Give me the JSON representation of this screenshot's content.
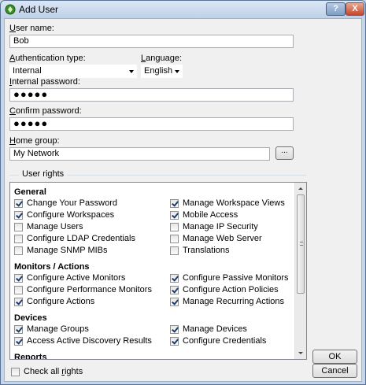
{
  "window": {
    "title": "Add User",
    "help_label": "?",
    "close_label": "X"
  },
  "form": {
    "username_label_u": "U",
    "username_label_rest": "ser name:",
    "username_value": "Bob",
    "auth_label_u": "A",
    "auth_label_rest": "uthentication type:",
    "auth_value": "Internal",
    "language_label_u": "L",
    "language_label_rest": "anguage:",
    "language_value": "English",
    "internal_password_label_u": "I",
    "internal_password_label_rest": "nternal password:",
    "internal_password_value": "●●●●●",
    "confirm_label_u": "C",
    "confirm_label_rest": "onfirm password:",
    "confirm_value": "●●●●●",
    "home_group_label_u": "H",
    "home_group_label_rest": "ome group:",
    "home_group_value": "My Network",
    "browse_label": "..."
  },
  "user_rights": {
    "group_title": "User rights",
    "sections": [
      {
        "name": "General",
        "items": [
          {
            "label": "Change Your Password",
            "checked": true
          },
          {
            "label": "Manage Workspace Views",
            "checked": true
          },
          {
            "label": "Configure Workspaces",
            "checked": true
          },
          {
            "label": "Mobile Access",
            "checked": true
          },
          {
            "label": "Manage Users",
            "checked": false
          },
          {
            "label": "Manage IP Security",
            "checked": false
          },
          {
            "label": "Configure LDAP Credentials",
            "checked": false
          },
          {
            "label": "Manage Web Server",
            "checked": false
          },
          {
            "label": "Manage SNMP MIBs",
            "checked": false
          },
          {
            "label": "Translations",
            "checked": false
          }
        ]
      },
      {
        "name": "Monitors / Actions",
        "items": [
          {
            "label": "Configure Active Monitors",
            "checked": true
          },
          {
            "label": "Configure Passive Monitors",
            "checked": true
          },
          {
            "label": "Configure Performance Monitors",
            "checked": false
          },
          {
            "label": "Configure Action Policies",
            "checked": true
          },
          {
            "label": "Configure Actions",
            "checked": true
          },
          {
            "label": "Manage Recurring Actions",
            "checked": true
          }
        ]
      },
      {
        "name": "Devices",
        "items": [
          {
            "label": "Manage Groups",
            "checked": true
          },
          {
            "label": "Manage Devices",
            "checked": true
          },
          {
            "label": "Access Active Discovery Results",
            "checked": true
          },
          {
            "label": "Configure Credentials",
            "checked": true
          }
        ]
      },
      {
        "name": "Reports",
        "items": []
      }
    ]
  },
  "buttons": {
    "ok": "OK",
    "cancel": "Cancel"
  },
  "check_all": {
    "label_pre": "Check all ",
    "label_u": "r",
    "label_post": "ights",
    "checked": false
  }
}
